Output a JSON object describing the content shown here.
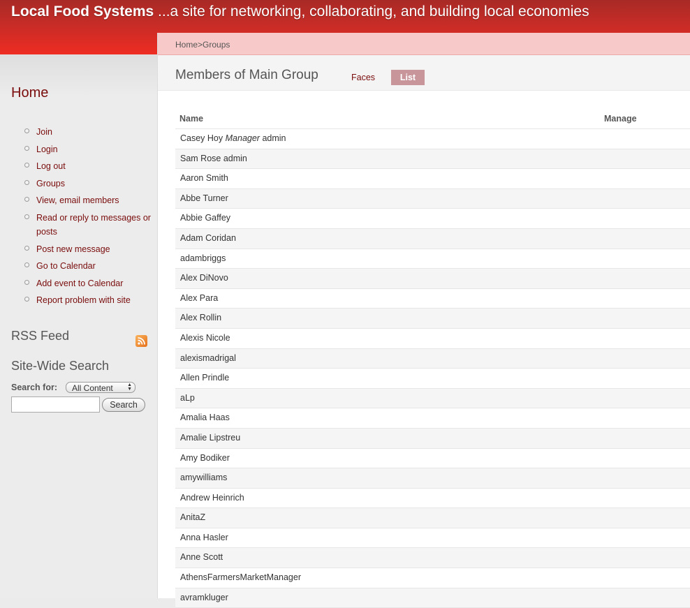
{
  "header": {
    "site_name": "Local Food Systems",
    "tagline": " ...a site for networking, collaborating, and building local economies"
  },
  "sidebar": {
    "home_title": "Home",
    "nav_items": [
      "Join",
      "Login",
      "Log out",
      "Groups",
      "View, email members",
      "Read or reply to messages or posts",
      "Post new message",
      "Go to Calendar",
      "Add event to Calendar",
      "Report problem with site"
    ],
    "rss_title": "RSS Feed",
    "search_title": "Site-Wide Search",
    "search_for_label": "Search for:",
    "search_scope": "All Content",
    "search_button": "Search",
    "search_value": ""
  },
  "breadcrumb": "Home>Groups",
  "page": {
    "title": "Members of Main Group",
    "tabs": [
      "Faces",
      "List"
    ],
    "active_tab": "List"
  },
  "table": {
    "headers": [
      "Name",
      "Manage"
    ],
    "rows": [
      {
        "name": "Casey Hoy",
        "role": "Manager",
        "suffix": "admin"
      },
      {
        "name": "Sam Rose",
        "role": "",
        "suffix": "admin"
      },
      {
        "name": "Aaron Smith",
        "role": "",
        "suffix": ""
      },
      {
        "name": "Abbe Turner",
        "role": "",
        "suffix": ""
      },
      {
        "name": "Abbie Gaffey",
        "role": "",
        "suffix": ""
      },
      {
        "name": "Adam Coridan",
        "role": "",
        "suffix": ""
      },
      {
        "name": "adambriggs",
        "role": "",
        "suffix": ""
      },
      {
        "name": "Alex DiNovo",
        "role": "",
        "suffix": ""
      },
      {
        "name": "Alex Para",
        "role": "",
        "suffix": ""
      },
      {
        "name": "Alex Rollin",
        "role": "",
        "suffix": ""
      },
      {
        "name": "Alexis Nicole",
        "role": "",
        "suffix": ""
      },
      {
        "name": "alexismadrigal",
        "role": "",
        "suffix": ""
      },
      {
        "name": "Allen Prindle",
        "role": "",
        "suffix": ""
      },
      {
        "name": "aLp",
        "role": "",
        "suffix": ""
      },
      {
        "name": "Amalia Haas",
        "role": "",
        "suffix": ""
      },
      {
        "name": "Amalie Lipstreu",
        "role": "",
        "suffix": ""
      },
      {
        "name": "Amy Bodiker",
        "role": "",
        "suffix": ""
      },
      {
        "name": "amywilliams",
        "role": "",
        "suffix": ""
      },
      {
        "name": "Andrew Heinrich",
        "role": "",
        "suffix": ""
      },
      {
        "name": "AnitaZ",
        "role": "",
        "suffix": ""
      },
      {
        "name": "Anna Hasler",
        "role": "",
        "suffix": ""
      },
      {
        "name": "Anne Scott",
        "role": "",
        "suffix": ""
      },
      {
        "name": "AthensFarmersMarketManager",
        "role": "",
        "suffix": ""
      },
      {
        "name": "avramkluger",
        "role": "",
        "suffix": ""
      }
    ]
  },
  "colors": {
    "header_red": "#c72c27",
    "link_maroon": "#7a0c0c",
    "breadcrumb_pink": "#f7c9c9",
    "active_tab": "#c8959a"
  }
}
